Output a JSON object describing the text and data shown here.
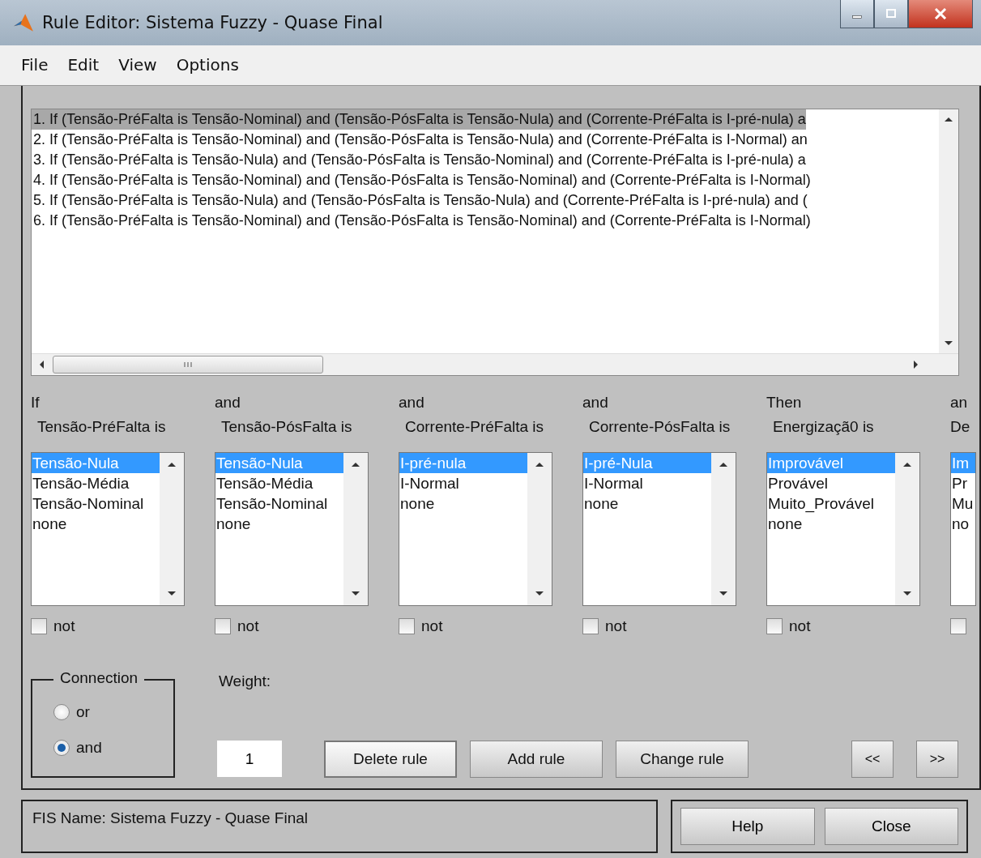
{
  "window": {
    "title": "Rule Editor: Sistema Fuzzy - Quase Final"
  },
  "menu": [
    "File",
    "Edit",
    "View",
    "Options"
  ],
  "rules": [
    {
      "text": "1. If (Tensão-PréFalta is Tensão-Nominal) and (Tensão-PósFalta is Tensão-Nula) and (Corrente-PréFalta is I-pré-nula) a",
      "selected": true
    },
    {
      "text": "2. If (Tensão-PréFalta is Tensão-Nominal) and (Tensão-PósFalta is Tensão-Nula) and (Corrente-PréFalta is I-Normal) an",
      "selected": false
    },
    {
      "text": "3. If (Tensão-PréFalta is Tensão-Nula) and (Tensão-PósFalta is Tensão-Nominal) and (Corrente-PréFalta is I-pré-nula) a",
      "selected": false
    },
    {
      "text": "4. If (Tensão-PréFalta is Tensão-Nominal) and (Tensão-PósFalta is Tensão-Nominal) and (Corrente-PréFalta is I-Normal)",
      "selected": false
    },
    {
      "text": "5. If (Tensão-PréFalta is Tensão-Nula) and (Tensão-PósFalta is Tensão-Nula) and (Corrente-PréFalta is I-pré-nula) and (",
      "selected": false
    },
    {
      "text": "6. If (Tensão-PréFalta is Tensão-Nominal) and (Tensão-PósFalta is Tensão-Nominal) and (Corrente-PréFalta is I-Normal)",
      "selected": false
    }
  ],
  "columns": [
    {
      "connector": "If",
      "variable": "Tensão-PréFalta is",
      "not_checked": false,
      "not_label": "not",
      "options": [
        {
          "label": "Tensão-Nula",
          "selected": true
        },
        {
          "label": "Tensão-Média",
          "selected": false
        },
        {
          "label": "Tensão-Nominal",
          "selected": false
        },
        {
          "label": "none",
          "selected": false
        }
      ]
    },
    {
      "connector": "and",
      "variable": "Tensão-PósFalta is",
      "not_checked": false,
      "not_label": "not",
      "options": [
        {
          "label": "Tensão-Nula",
          "selected": true
        },
        {
          "label": "Tensão-Média",
          "selected": false
        },
        {
          "label": "Tensão-Nominal",
          "selected": false
        },
        {
          "label": "none",
          "selected": false
        }
      ]
    },
    {
      "connector": "and",
      "variable": "Corrente-PréFalta is",
      "not_checked": false,
      "not_label": "not",
      "options": [
        {
          "label": "I-pré-nula",
          "selected": true
        },
        {
          "label": "I-Normal",
          "selected": false
        },
        {
          "label": "none",
          "selected": false
        }
      ]
    },
    {
      "connector": "and",
      "variable": "Corrente-PósFalta is",
      "not_checked": false,
      "not_label": "not",
      "options": [
        {
          "label": "I-pré-Nula",
          "selected": true
        },
        {
          "label": "I-Normal",
          "selected": false
        },
        {
          "label": "none",
          "selected": false
        }
      ]
    },
    {
      "connector": "Then",
      "variable": "Energizaçã0 is",
      "not_checked": false,
      "not_label": "not",
      "options": [
        {
          "label": "Improvável",
          "selected": true
        },
        {
          "label": "Provável",
          "selected": false
        },
        {
          "label": "Muito_Provável",
          "selected": false
        },
        {
          "label": "none",
          "selected": false
        }
      ]
    },
    {
      "connector": "an",
      "variable": "De",
      "not_checked": false,
      "options": [
        {
          "label": "Im",
          "selected": true
        },
        {
          "label": "Pr",
          "selected": false
        },
        {
          "label": "Mu",
          "selected": false
        },
        {
          "label": "no",
          "selected": false
        }
      ]
    }
  ],
  "connection": {
    "title": "Connection",
    "options": [
      {
        "label": "or",
        "selected": false
      },
      {
        "label": "and",
        "selected": true
      }
    ]
  },
  "weight": {
    "label": "Weight:",
    "value": "1"
  },
  "buttons": [
    "Delete rule",
    "Add rule",
    "Change rule"
  ],
  "nav_buttons": [
    "<<",
    ">>"
  ],
  "status": "FIS Name: Sistema Fuzzy - Quase Final",
  "footer_buttons": [
    "Help",
    "Close"
  ]
}
